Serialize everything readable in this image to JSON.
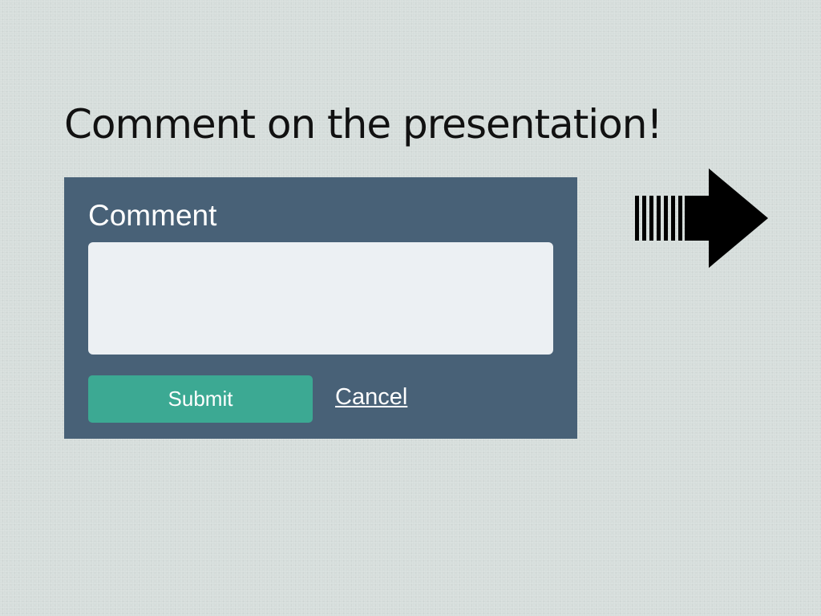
{
  "page": {
    "title": "Comment on the presentation!"
  },
  "comment_form": {
    "label": "Comment",
    "input_value": "",
    "submit_label": "Submit",
    "cancel_label": "Cancel"
  },
  "navigation": {
    "next_icon": "striped-right-arrow-icon"
  },
  "colors": {
    "background": "#d5dddb",
    "panel": "#486177",
    "input_background": "#ecf0f3",
    "submit_button": "#3ca993",
    "text_light": "#ffffff",
    "title_text": "#111111",
    "arrow": "#000000"
  }
}
